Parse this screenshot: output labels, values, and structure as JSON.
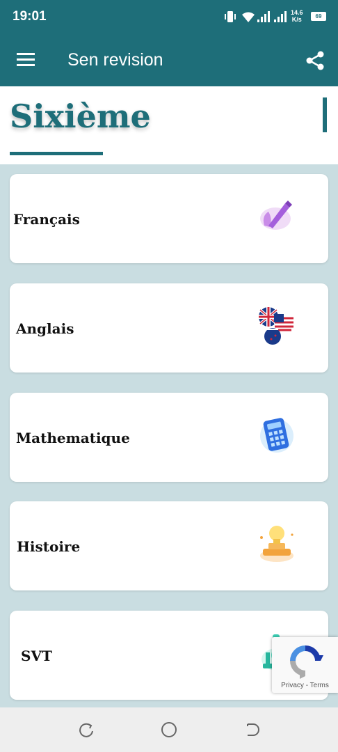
{
  "status_bar": {
    "time": "19:01",
    "net_speed_value": "14.6",
    "net_speed_unit": "K/s",
    "battery": "69"
  },
  "app_bar": {
    "title": "Sen revision",
    "menu_icon": "hamburger-menu-icon",
    "share_icon": "share-icon"
  },
  "header": {
    "title": "Sixième"
  },
  "subjects": [
    {
      "label": "Français",
      "icon": "pen-icon"
    },
    {
      "label": "Anglais",
      "icon": "flags-icon"
    },
    {
      "label": "Mathematique",
      "icon": "calculator-icon"
    },
    {
      "label": "Histoire",
      "icon": "lightbulb-icon"
    },
    {
      "label": "SVT",
      "icon": "microscope-icon"
    }
  ],
  "recaptcha": {
    "privacy": "Privacy",
    "separator": "-",
    "terms": "Terms"
  },
  "colors": {
    "primary": "#1e6e79",
    "background": "#c9dde1"
  }
}
